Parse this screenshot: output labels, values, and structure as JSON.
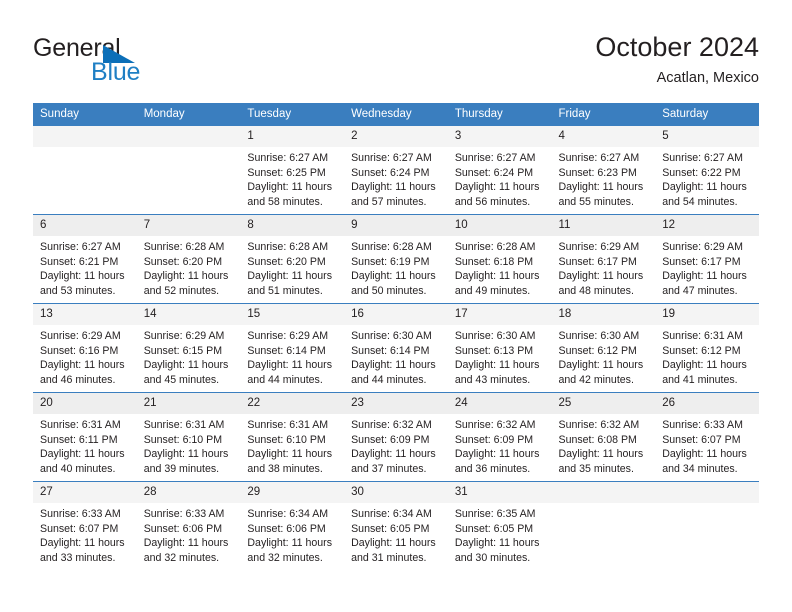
{
  "brand": {
    "name_top": "General",
    "name_bottom": "Blue",
    "triangle_color": "#0c6fb8",
    "blue_color": "#1f7fc4"
  },
  "header": {
    "month_title": "October 2024",
    "location": "Acatlan, Mexico"
  },
  "theme": {
    "header_blue": "#3a7ebf",
    "daynum_band": "#f0f0f0",
    "text": "#231f20"
  },
  "calendar": {
    "weekday_headers": [
      "Sunday",
      "Monday",
      "Tuesday",
      "Wednesday",
      "Thursday",
      "Friday",
      "Saturday"
    ],
    "weeks": [
      [
        {
          "day": "",
          "empty": true
        },
        {
          "day": "",
          "empty": true
        },
        {
          "day": "1",
          "sunrise": "Sunrise: 6:27 AM",
          "sunset": "Sunset: 6:25 PM",
          "daylight": "Daylight: 11 hours and 58 minutes."
        },
        {
          "day": "2",
          "sunrise": "Sunrise: 6:27 AM",
          "sunset": "Sunset: 6:24 PM",
          "daylight": "Daylight: 11 hours and 57 minutes."
        },
        {
          "day": "3",
          "sunrise": "Sunrise: 6:27 AM",
          "sunset": "Sunset: 6:24 PM",
          "daylight": "Daylight: 11 hours and 56 minutes."
        },
        {
          "day": "4",
          "sunrise": "Sunrise: 6:27 AM",
          "sunset": "Sunset: 6:23 PM",
          "daylight": "Daylight: 11 hours and 55 minutes."
        },
        {
          "day": "5",
          "sunrise": "Sunrise: 6:27 AM",
          "sunset": "Sunset: 6:22 PM",
          "daylight": "Daylight: 11 hours and 54 minutes."
        }
      ],
      [
        {
          "day": "6",
          "sunrise": "Sunrise: 6:27 AM",
          "sunset": "Sunset: 6:21 PM",
          "daylight": "Daylight: 11 hours and 53 minutes."
        },
        {
          "day": "7",
          "sunrise": "Sunrise: 6:28 AM",
          "sunset": "Sunset: 6:20 PM",
          "daylight": "Daylight: 11 hours and 52 minutes."
        },
        {
          "day": "8",
          "sunrise": "Sunrise: 6:28 AM",
          "sunset": "Sunset: 6:20 PM",
          "daylight": "Daylight: 11 hours and 51 minutes."
        },
        {
          "day": "9",
          "sunrise": "Sunrise: 6:28 AM",
          "sunset": "Sunset: 6:19 PM",
          "daylight": "Daylight: 11 hours and 50 minutes."
        },
        {
          "day": "10",
          "sunrise": "Sunrise: 6:28 AM",
          "sunset": "Sunset: 6:18 PM",
          "daylight": "Daylight: 11 hours and 49 minutes."
        },
        {
          "day": "11",
          "sunrise": "Sunrise: 6:29 AM",
          "sunset": "Sunset: 6:17 PM",
          "daylight": "Daylight: 11 hours and 48 minutes."
        },
        {
          "day": "12",
          "sunrise": "Sunrise: 6:29 AM",
          "sunset": "Sunset: 6:17 PM",
          "daylight": "Daylight: 11 hours and 47 minutes."
        }
      ],
      [
        {
          "day": "13",
          "sunrise": "Sunrise: 6:29 AM",
          "sunset": "Sunset: 6:16 PM",
          "daylight": "Daylight: 11 hours and 46 minutes."
        },
        {
          "day": "14",
          "sunrise": "Sunrise: 6:29 AM",
          "sunset": "Sunset: 6:15 PM",
          "daylight": "Daylight: 11 hours and 45 minutes."
        },
        {
          "day": "15",
          "sunrise": "Sunrise: 6:29 AM",
          "sunset": "Sunset: 6:14 PM",
          "daylight": "Daylight: 11 hours and 44 minutes."
        },
        {
          "day": "16",
          "sunrise": "Sunrise: 6:30 AM",
          "sunset": "Sunset: 6:14 PM",
          "daylight": "Daylight: 11 hours and 44 minutes."
        },
        {
          "day": "17",
          "sunrise": "Sunrise: 6:30 AM",
          "sunset": "Sunset: 6:13 PM",
          "daylight": "Daylight: 11 hours and 43 minutes."
        },
        {
          "day": "18",
          "sunrise": "Sunrise: 6:30 AM",
          "sunset": "Sunset: 6:12 PM",
          "daylight": "Daylight: 11 hours and 42 minutes."
        },
        {
          "day": "19",
          "sunrise": "Sunrise: 6:31 AM",
          "sunset": "Sunset: 6:12 PM",
          "daylight": "Daylight: 11 hours and 41 minutes."
        }
      ],
      [
        {
          "day": "20",
          "sunrise": "Sunrise: 6:31 AM",
          "sunset": "Sunset: 6:11 PM",
          "daylight": "Daylight: 11 hours and 40 minutes."
        },
        {
          "day": "21",
          "sunrise": "Sunrise: 6:31 AM",
          "sunset": "Sunset: 6:10 PM",
          "daylight": "Daylight: 11 hours and 39 minutes."
        },
        {
          "day": "22",
          "sunrise": "Sunrise: 6:31 AM",
          "sunset": "Sunset: 6:10 PM",
          "daylight": "Daylight: 11 hours and 38 minutes."
        },
        {
          "day": "23",
          "sunrise": "Sunrise: 6:32 AM",
          "sunset": "Sunset: 6:09 PM",
          "daylight": "Daylight: 11 hours and 37 minutes."
        },
        {
          "day": "24",
          "sunrise": "Sunrise: 6:32 AM",
          "sunset": "Sunset: 6:09 PM",
          "daylight": "Daylight: 11 hours and 36 minutes."
        },
        {
          "day": "25",
          "sunrise": "Sunrise: 6:32 AM",
          "sunset": "Sunset: 6:08 PM",
          "daylight": "Daylight: 11 hours and 35 minutes."
        },
        {
          "day": "26",
          "sunrise": "Sunrise: 6:33 AM",
          "sunset": "Sunset: 6:07 PM",
          "daylight": "Daylight: 11 hours and 34 minutes."
        }
      ],
      [
        {
          "day": "27",
          "sunrise": "Sunrise: 6:33 AM",
          "sunset": "Sunset: 6:07 PM",
          "daylight": "Daylight: 11 hours and 33 minutes."
        },
        {
          "day": "28",
          "sunrise": "Sunrise: 6:33 AM",
          "sunset": "Sunset: 6:06 PM",
          "daylight": "Daylight: 11 hours and 32 minutes."
        },
        {
          "day": "29",
          "sunrise": "Sunrise: 6:34 AM",
          "sunset": "Sunset: 6:06 PM",
          "daylight": "Daylight: 11 hours and 32 minutes."
        },
        {
          "day": "30",
          "sunrise": "Sunrise: 6:34 AM",
          "sunset": "Sunset: 6:05 PM",
          "daylight": "Daylight: 11 hours and 31 minutes."
        },
        {
          "day": "31",
          "sunrise": "Sunrise: 6:35 AM",
          "sunset": "Sunset: 6:05 PM",
          "daylight": "Daylight: 11 hours and 30 minutes."
        },
        {
          "day": "",
          "empty": true
        },
        {
          "day": "",
          "empty": true
        }
      ]
    ]
  }
}
